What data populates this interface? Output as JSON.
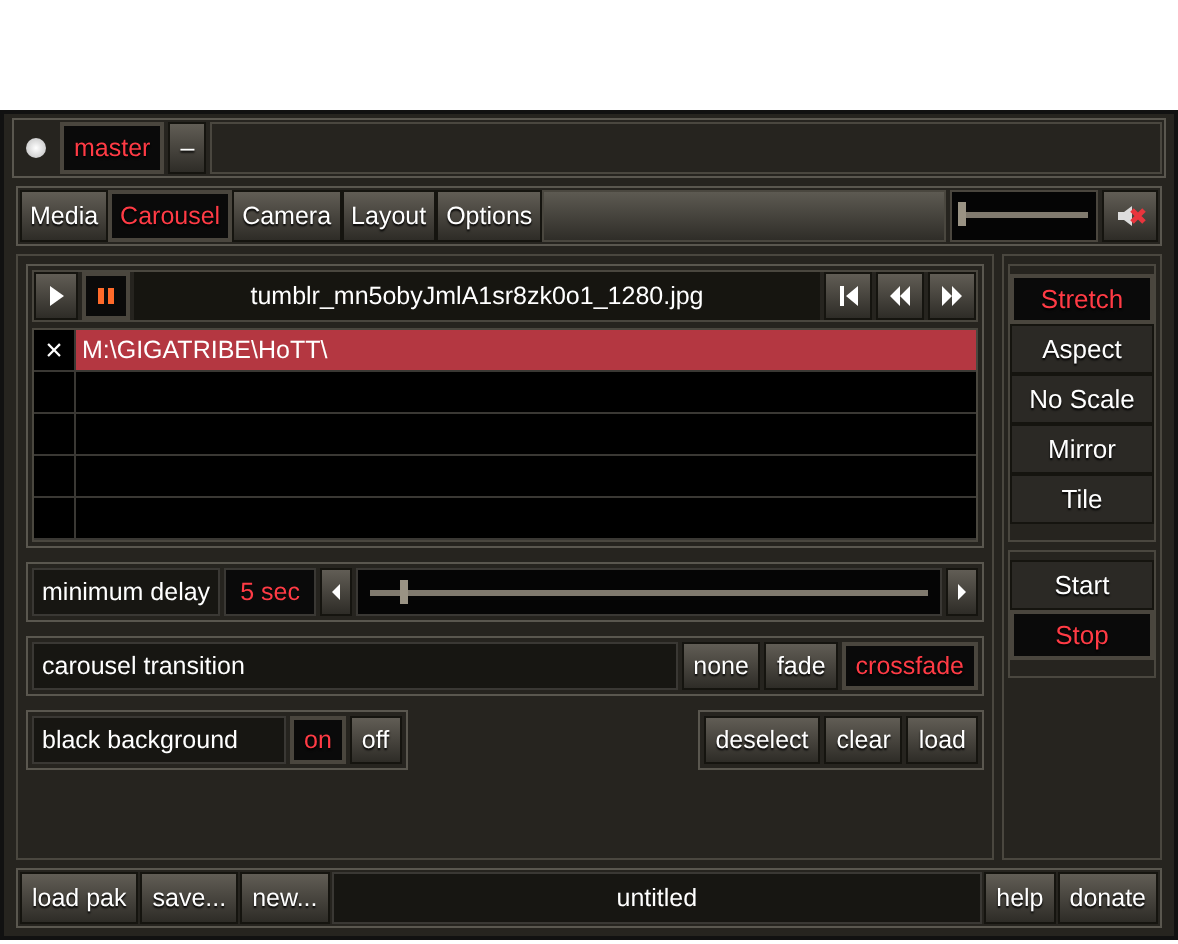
{
  "header": {
    "master": {
      "label": "master",
      "selected": true
    },
    "collapse": "–"
  },
  "tabs": [
    {
      "label": "Media",
      "selected": false
    },
    {
      "label": "Carousel",
      "selected": true
    },
    {
      "label": "Camera",
      "selected": false
    },
    {
      "label": "Layout",
      "selected": false
    },
    {
      "label": "Options",
      "selected": false
    }
  ],
  "volume": {
    "level": 0.04,
    "muted": true
  },
  "transport": {
    "paused": true,
    "filename": "tumblr_mn5obyJmlA1sr8zk0o1_1280.jpg"
  },
  "file_list": {
    "rows": [
      {
        "remove": "×",
        "path": "M:\\GIGATRIBE\\HoTT\\",
        "selected": true
      }
    ]
  },
  "scale_modes": [
    {
      "label": "Stretch",
      "selected": true
    },
    {
      "label": "Aspect",
      "selected": false
    },
    {
      "label": "No Scale",
      "selected": false
    },
    {
      "label": "Mirror",
      "selected": false
    },
    {
      "label": "Tile",
      "selected": false
    }
  ],
  "run_controls": [
    {
      "label": "Start",
      "selected": false
    },
    {
      "label": "Stop",
      "selected": true
    }
  ],
  "delay": {
    "label": "minimum delay",
    "value": "5 sec",
    "level": 0.05
  },
  "transition": {
    "label": "carousel transition",
    "options": [
      {
        "label": "none",
        "selected": false
      },
      {
        "label": "fade",
        "selected": false
      },
      {
        "label": "crossfade",
        "selected": true
      }
    ]
  },
  "background": {
    "label": "black background",
    "options": [
      {
        "label": "on",
        "selected": true
      },
      {
        "label": "off",
        "selected": false
      }
    ]
  },
  "list_actions": [
    "deselect",
    "clear",
    "load"
  ],
  "footer": {
    "left": [
      "load pak",
      "save...",
      "new..."
    ],
    "project": "untitled",
    "right": [
      "help",
      "donate"
    ]
  }
}
